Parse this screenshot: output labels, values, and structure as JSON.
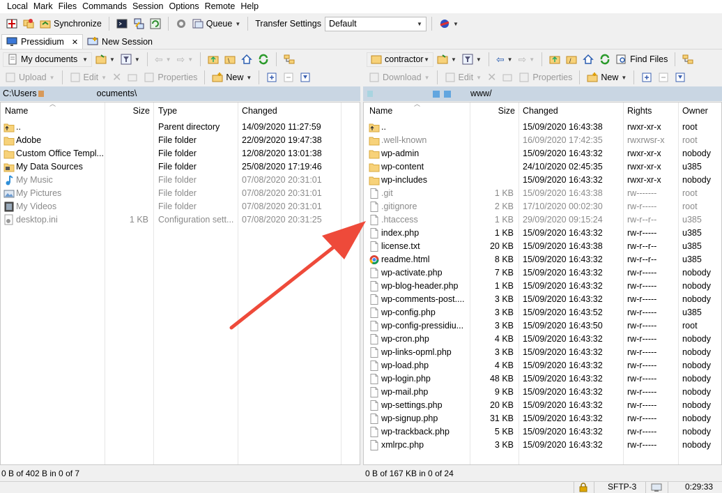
{
  "menu": [
    "Local",
    "Mark",
    "Files",
    "Commands",
    "Session",
    "Options",
    "Remote",
    "Help"
  ],
  "toolbar": {
    "synchronize_label": "Synchronize",
    "queue_label": "Queue",
    "transfer_settings_label": "Transfer Settings",
    "transfer_settings_value": "Default"
  },
  "tabs": [
    {
      "label": "Pressidium",
      "close": "✕"
    },
    {
      "label": "New Session"
    }
  ],
  "left": {
    "location": "My documents",
    "upload_label": "Upload",
    "edit_label": "Edit",
    "properties_label": "Properties",
    "new_label": "New",
    "path_start": "C:\\Users",
    "path_end": "ocuments\\",
    "columns": {
      "name": "Name",
      "size": "Size",
      "type": "Type",
      "changed": "Changed"
    },
    "rows": [
      {
        "name": "..",
        "size": "",
        "type": "Parent directory",
        "changed": "14/09/2020  11:27:59",
        "icon": "parent-folder",
        "dim": false
      },
      {
        "name": "Adobe",
        "size": "",
        "type": "File folder",
        "changed": "22/09/2020  19:47:38",
        "icon": "folder",
        "dim": false
      },
      {
        "name": "Custom Office Templ...",
        "size": "",
        "type": "File folder",
        "changed": "12/08/2020  13:01:38",
        "icon": "folder",
        "dim": false
      },
      {
        "name": "My Data Sources",
        "size": "",
        "type": "File folder",
        "changed": "25/08/2020  17:19:46",
        "icon": "data-sources",
        "dim": false
      },
      {
        "name": "My Music",
        "size": "",
        "type": "File folder",
        "changed": "07/08/2020  20:31:01",
        "icon": "music",
        "dim": true
      },
      {
        "name": "My Pictures",
        "size": "",
        "type": "File folder",
        "changed": "07/08/2020  20:31:01",
        "icon": "pictures",
        "dim": true
      },
      {
        "name": "My Videos",
        "size": "",
        "type": "File folder",
        "changed": "07/08/2020  20:31:01",
        "icon": "videos",
        "dim": true
      },
      {
        "name": "desktop.ini",
        "size": "1 KB",
        "type": "Configuration sett...",
        "changed": "07/08/2020  20:31:25",
        "icon": "settings-file",
        "dim": true
      }
    ],
    "status": "0 B of 402 B in 0 of 7"
  },
  "right": {
    "location": "contractor",
    "download_label": "Download",
    "edit_label": "Edit",
    "properties_label": "Properties",
    "new_label": "New",
    "find_files_label": "Find Files",
    "path_end": "www/",
    "columns": {
      "name": "Name",
      "size": "Size",
      "changed": "Changed",
      "rights": "Rights",
      "owner": "Owner"
    },
    "rows": [
      {
        "name": "..",
        "size": "",
        "changed": "15/09/2020 16:43:38",
        "rights": "rwxr-xr-x",
        "owner": "root",
        "icon": "parent-folder",
        "dim": false
      },
      {
        "name": ".well-known",
        "size": "",
        "changed": "16/09/2020 17:42:35",
        "rights": "rwxrwsr-x",
        "owner": "root",
        "icon": "folder",
        "dim": true
      },
      {
        "name": "wp-admin",
        "size": "",
        "changed": "15/09/2020 16:43:32",
        "rights": "rwxr-xr-x",
        "owner": "nobody",
        "icon": "folder",
        "dim": false
      },
      {
        "name": "wp-content",
        "size": "",
        "changed": "24/10/2020 02:45:35",
        "rights": "rwxr-xr-x",
        "owner": "u385",
        "icon": "folder",
        "dim": false
      },
      {
        "name": "wp-includes",
        "size": "",
        "changed": "15/09/2020 16:43:32",
        "rights": "rwxr-xr-x",
        "owner": "nobody",
        "icon": "folder",
        "dim": false
      },
      {
        "name": ".git",
        "size": "1 KB",
        "changed": "15/09/2020 16:43:38",
        "rights": "rw-------",
        "owner": "root",
        "icon": "file",
        "dim": true
      },
      {
        "name": ".gitignore",
        "size": "2 KB",
        "changed": "17/10/2020 00:02:30",
        "rights": "rw-r-----",
        "owner": "root",
        "icon": "file",
        "dim": true
      },
      {
        "name": ".htaccess",
        "size": "1 KB",
        "changed": "29/09/2020 09:15:24",
        "rights": "rw-r--r--",
        "owner": "u385",
        "icon": "file",
        "dim": true
      },
      {
        "name": "index.php",
        "size": "1 KB",
        "changed": "15/09/2020 16:43:32",
        "rights": "rw-r-----",
        "owner": "u385",
        "icon": "file",
        "dim": false
      },
      {
        "name": "license.txt",
        "size": "20 KB",
        "changed": "15/09/2020 16:43:38",
        "rights": "rw-r--r--",
        "owner": "u385",
        "icon": "file",
        "dim": false
      },
      {
        "name": "readme.html",
        "size": "8 KB",
        "changed": "15/09/2020 16:43:32",
        "rights": "rw-r--r--",
        "owner": "u385",
        "icon": "chrome",
        "dim": false
      },
      {
        "name": "wp-activate.php",
        "size": "7 KB",
        "changed": "15/09/2020 16:43:32",
        "rights": "rw-r-----",
        "owner": "nobody",
        "icon": "file",
        "dim": false
      },
      {
        "name": "wp-blog-header.php",
        "size": "1 KB",
        "changed": "15/09/2020 16:43:32",
        "rights": "rw-r-----",
        "owner": "nobody",
        "icon": "file",
        "dim": false
      },
      {
        "name": "wp-comments-post....",
        "size": "3 KB",
        "changed": "15/09/2020 16:43:32",
        "rights": "rw-r-----",
        "owner": "nobody",
        "icon": "file",
        "dim": false
      },
      {
        "name": "wp-config.php",
        "size": "3 KB",
        "changed": "15/09/2020 16:43:52",
        "rights": "rw-r-----",
        "owner": "u385",
        "icon": "file",
        "dim": false
      },
      {
        "name": "wp-config-pressidiu...",
        "size": "3 KB",
        "changed": "15/09/2020 16:43:50",
        "rights": "rw-r-----",
        "owner": "root",
        "icon": "file",
        "dim": false
      },
      {
        "name": "wp-cron.php",
        "size": "4 KB",
        "changed": "15/09/2020 16:43:32",
        "rights": "rw-r-----",
        "owner": "nobody",
        "icon": "file",
        "dim": false
      },
      {
        "name": "wp-links-opml.php",
        "size": "3 KB",
        "changed": "15/09/2020 16:43:32",
        "rights": "rw-r-----",
        "owner": "nobody",
        "icon": "file",
        "dim": false
      },
      {
        "name": "wp-load.php",
        "size": "4 KB",
        "changed": "15/09/2020 16:43:32",
        "rights": "rw-r-----",
        "owner": "nobody",
        "icon": "file",
        "dim": false
      },
      {
        "name": "wp-login.php",
        "size": "48 KB",
        "changed": "15/09/2020 16:43:32",
        "rights": "rw-r-----",
        "owner": "nobody",
        "icon": "file",
        "dim": false
      },
      {
        "name": "wp-mail.php",
        "size": "9 KB",
        "changed": "15/09/2020 16:43:32",
        "rights": "rw-r-----",
        "owner": "nobody",
        "icon": "file",
        "dim": false
      },
      {
        "name": "wp-settings.php",
        "size": "20 KB",
        "changed": "15/09/2020 16:43:32",
        "rights": "rw-r-----",
        "owner": "nobody",
        "icon": "file",
        "dim": false
      },
      {
        "name": "wp-signup.php",
        "size": "31 KB",
        "changed": "15/09/2020 16:43:32",
        "rights": "rw-r-----",
        "owner": "nobody",
        "icon": "file",
        "dim": false
      },
      {
        "name": "wp-trackback.php",
        "size": "5 KB",
        "changed": "15/09/2020 16:43:32",
        "rights": "rw-r-----",
        "owner": "nobody",
        "icon": "file",
        "dim": false
      },
      {
        "name": "xmlrpc.php",
        "size": "3 KB",
        "changed": "15/09/2020 16:43:32",
        "rights": "rw-r-----",
        "owner": "nobody",
        "icon": "file",
        "dim": false
      }
    ],
    "status": "0 B of 167 KB in 0 of 24"
  },
  "footer": {
    "protocol": "SFTP-3",
    "elapsed": "0:29:33"
  },
  "colors": {
    "path_bar": "#c9d6e3",
    "arrow": "#ee4a3a",
    "folder": "#f7d27a"
  }
}
